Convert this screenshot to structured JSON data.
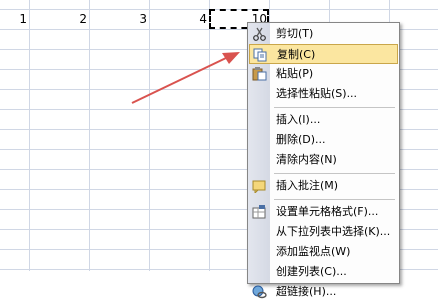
{
  "sheet": {
    "row1": [
      "1",
      "2",
      "3",
      "4",
      "10"
    ]
  },
  "context_menu": {
    "items": [
      {
        "label": "剪切(T)",
        "icon": "scissors-icon"
      },
      {
        "label": "复制(C)",
        "icon": "copy-icon",
        "highlighted": true
      },
      {
        "label": "粘贴(P)",
        "icon": "paste-icon"
      },
      {
        "label": "选择性粘贴(S)..."
      },
      {
        "label": "插入(I)..."
      },
      {
        "label": "删除(D)..."
      },
      {
        "label": "清除内容(N)"
      },
      {
        "label": "插入批注(M)",
        "icon": "comment-icon"
      },
      {
        "label": "设置单元格格式(F)...",
        "icon": "format-cells-icon"
      },
      {
        "label": "从下拉列表中选择(K)..."
      },
      {
        "label": "添加监视点(W)"
      },
      {
        "label": "创建列表(C)..."
      },
      {
        "label": "超链接(H)...",
        "icon": "hyperlink-icon"
      }
    ]
  },
  "colors": {
    "highlight": "#fbe6a0",
    "arrow": "#d9534f"
  }
}
